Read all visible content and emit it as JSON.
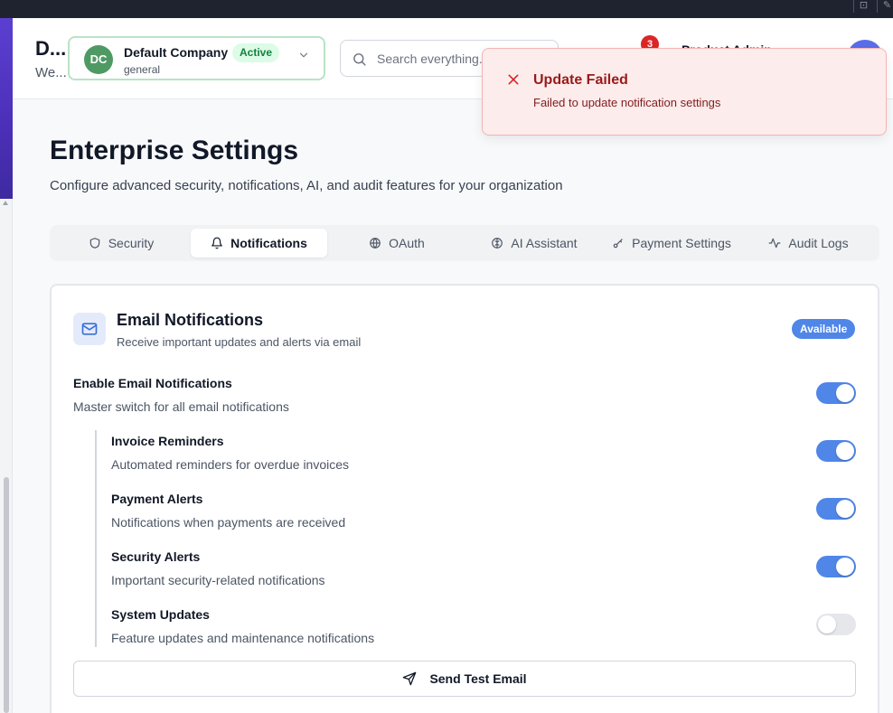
{
  "header": {
    "brand_title": "D...",
    "brand_sub": "We...",
    "company": {
      "initials": "DC",
      "name": "Default Company",
      "status": "Active",
      "sub": "general"
    },
    "search": {
      "placeholder": "Search everything..."
    },
    "notifications_count": "3",
    "user_name": "Product Admin"
  },
  "toast": {
    "title": "Update Failed",
    "message": "Failed to update notification settings"
  },
  "page": {
    "title": "Enterprise Settings",
    "subtitle": "Configure advanced security, notifications, AI, and audit features for your organization"
  },
  "tabs": [
    {
      "label": "Security",
      "icon": "shield-icon",
      "active": false
    },
    {
      "label": "Notifications",
      "icon": "bell-icon",
      "active": true
    },
    {
      "label": "OAuth",
      "icon": "globe-icon",
      "active": false
    },
    {
      "label": "AI Assistant",
      "icon": "brain-icon",
      "active": false
    },
    {
      "label": "Payment Settings",
      "icon": "key-icon",
      "active": false
    },
    {
      "label": "Audit Logs",
      "icon": "activity-icon",
      "active": false
    }
  ],
  "email": {
    "title": "Email Notifications",
    "subtitle": "Receive important updates and alerts via email",
    "badge": "Available",
    "master": {
      "label": "Enable Email Notifications",
      "desc": "Master switch for all email notifications",
      "enabled": true
    },
    "items": [
      {
        "label": "Invoice Reminders",
        "desc": "Automated reminders for overdue invoices",
        "enabled": true
      },
      {
        "label": "Payment Alerts",
        "desc": "Notifications when payments are received",
        "enabled": true
      },
      {
        "label": "Security Alerts",
        "desc": "Important security-related notifications",
        "enabled": true
      },
      {
        "label": "System Updates",
        "desc": "Feature updates and maintenance notifications",
        "enabled": false
      }
    ],
    "send_test_label": "Send Test Email"
  },
  "colors": {
    "accent": "#4f86e8",
    "error": "#991b1b",
    "success_badge": "#dcfce7"
  }
}
